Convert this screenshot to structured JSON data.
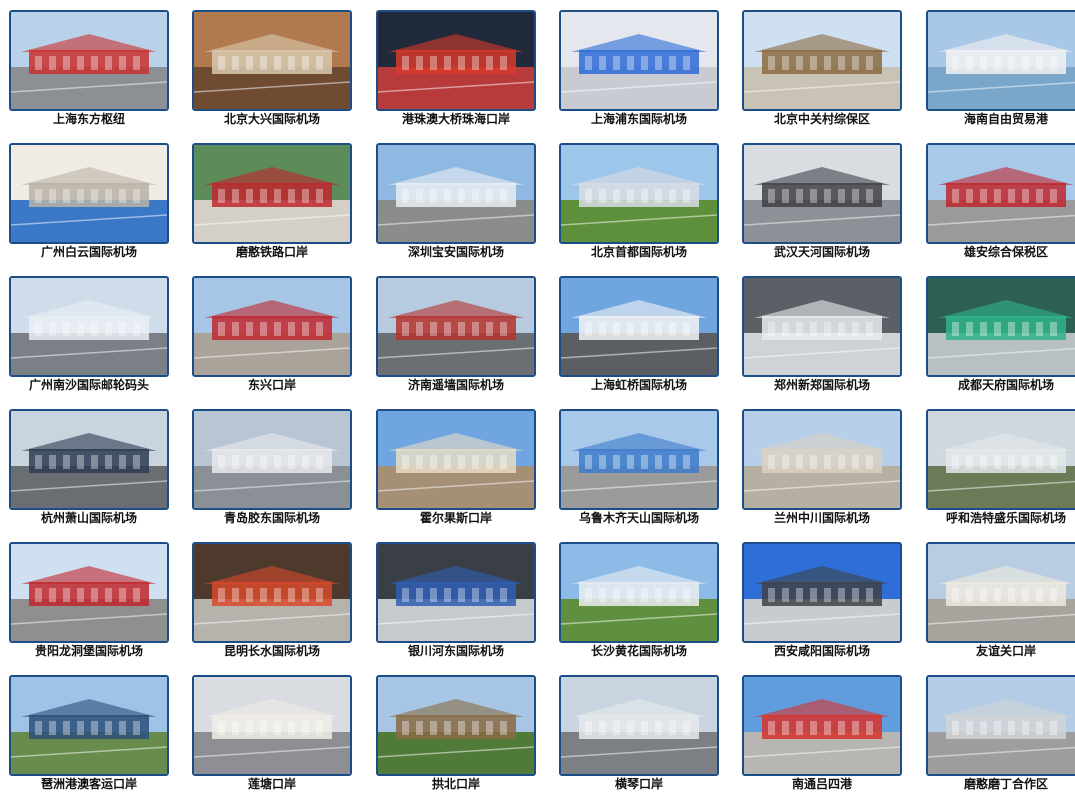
{
  "items": [
    {
      "label": "上海东方枢纽",
      "sky": "#b8d2ea",
      "ground": "#8c8f93",
      "accent": "#c9302c"
    },
    {
      "label": "北京大兴国际机场",
      "sky": "#b07a4e",
      "ground": "#6f4b32",
      "accent": "#d8c9b0"
    },
    {
      "label": "港珠澳大桥珠海口岸",
      "sky": "#202a3a",
      "ground": "#b83b3b",
      "accent": "#d73a2b"
    },
    {
      "label": "上海浦东国际机场",
      "sky": "#e4e8ee",
      "ground": "#c8ccd2",
      "accent": "#2d6ad6"
    },
    {
      "label": "北京中关村综保区",
      "sky": "#cfe0f3",
      "ground": "#c9c3b6",
      "accent": "#8b6a3e"
    },
    {
      "label": "海南自由贸易港",
      "sky": "#a9c7e6",
      "ground": "#7aa6c9",
      "accent": "#f2f2f2"
    },
    {
      "label": "广州白云国际机场",
      "sky": "#f0ece4",
      "ground": "#3b78c7",
      "accent": "#b9b3a6"
    },
    {
      "label": "磨憨铁路口岸",
      "sky": "#5d8b5a",
      "ground": "#d4d0c8",
      "accent": "#c0272d"
    },
    {
      "label": "深圳宝安国际机场",
      "sky": "#8fb9e3",
      "ground": "#8b8d8a",
      "accent": "#e9edf2"
    },
    {
      "label": "北京首都国际机场",
      "sky": "#9ec6eb",
      "ground": "#5e8f3a",
      "accent": "#d8dde3"
    },
    {
      "label": "武汉天河国际机场",
      "sky": "#d9dde2",
      "ground": "#8d9096",
      "accent": "#3e4147"
    },
    {
      "label": "雄安综合保税区",
      "sky": "#a8c9ea",
      "ground": "#9a9a9a",
      "accent": "#c0272d"
    },
    {
      "label": "广州南沙国际邮轮码头",
      "sky": "#cfdcea",
      "ground": "#7b8087",
      "accent": "#e9eef3"
    },
    {
      "label": "东兴口岸",
      "sky": "#a7c6e6",
      "ground": "#a9a39a",
      "accent": "#c0272d"
    },
    {
      "label": "济南遥墙国际机场",
      "sky": "#b6cbe0",
      "ground": "#6b6e73",
      "accent": "#b5322d"
    },
    {
      "label": "上海虹桥国际机场",
      "sky": "#6fa6e0",
      "ground": "#5b5e63",
      "accent": "#f3f3f3"
    },
    {
      "label": "郑州新郑国际机场",
      "sky": "#5b5f66",
      "ground": "#cfd3d8",
      "accent": "#e9ecef"
    },
    {
      "label": "成都天府国际机场",
      "sky": "#2e5f55",
      "ground": "#b8c0c4",
      "accent": "#2fb58a"
    },
    {
      "label": "杭州萧山国际机场",
      "sky": "#c9d4de",
      "ground": "#6a6d71",
      "accent": "#2b3b52"
    },
    {
      "label": "青岛胶东国际机场",
      "sky": "#b8c5d2",
      "ground": "#8a9096",
      "accent": "#e6e9ec"
    },
    {
      "label": "霍尔果斯口岸",
      "sky": "#6fa5e0",
      "ground": "#a58f75",
      "accent": "#e8dcc6"
    },
    {
      "label": "乌鲁木齐天山国际机场",
      "sky": "#a9c9ea",
      "ground": "#9b9b9b",
      "accent": "#3d7cc9"
    },
    {
      "label": "兰州中川国际机场",
      "sky": "#b7cfe8",
      "ground": "#b6b0a3",
      "accent": "#d9d2c3"
    },
    {
      "label": "呼和浩特盛乐国际机场",
      "sky": "#cfd8df",
      "ground": "#6b7b58",
      "accent": "#e3e7ea"
    },
    {
      "label": "贵阳龙洞堡国际机场",
      "sky": "#cfe0f0",
      "ground": "#8f8f8f",
      "accent": "#c0272d"
    },
    {
      "label": "昆明长水国际机场",
      "sky": "#4d3a2d",
      "ground": "#b6b3ad",
      "accent": "#d84a2b"
    },
    {
      "label": "银川河东国际机场",
      "sky": "#3a3f47",
      "ground": "#c6c9cd",
      "accent": "#2f5fb4"
    },
    {
      "label": "长沙黄花国际机场",
      "sky": "#8dbbe8",
      "ground": "#5f8f3f",
      "accent": "#e9edf1"
    },
    {
      "label": "西安咸阳国际机场",
      "sky": "#2f6ed6",
      "ground": "#c8ccd1",
      "accent": "#3f4247"
    },
    {
      "label": "友谊关口岸",
      "sky": "#b9cde2",
      "ground": "#a7a49e",
      "accent": "#efe9de"
    },
    {
      "label": "琶洲港澳客运口岸",
      "sky": "#9ec3e6",
      "ground": "#6a8b4e",
      "accent": "#2b4f7a"
    },
    {
      "label": "莲塘口岸",
      "sky": "#d9dde2",
      "ground": "#8d8f92",
      "accent": "#f0ede6"
    },
    {
      "label": "拱北口岸",
      "sky": "#a7c6e6",
      "ground": "#4f7a38",
      "accent": "#8a6a43"
    },
    {
      "label": "横琴口岸",
      "sky": "#c8d4df",
      "ground": "#7c8085",
      "accent": "#e6e9ec"
    },
    {
      "label": "南通吕四港",
      "sky": "#5f9ddf",
      "ground": "#b7b6b2",
      "accent": "#d8322c"
    },
    {
      "label": "磨憨磨丁合作区",
      "sky": "#b4cde6",
      "ground": "#9e9e9e",
      "accent": "#d0d3d6"
    }
  ]
}
